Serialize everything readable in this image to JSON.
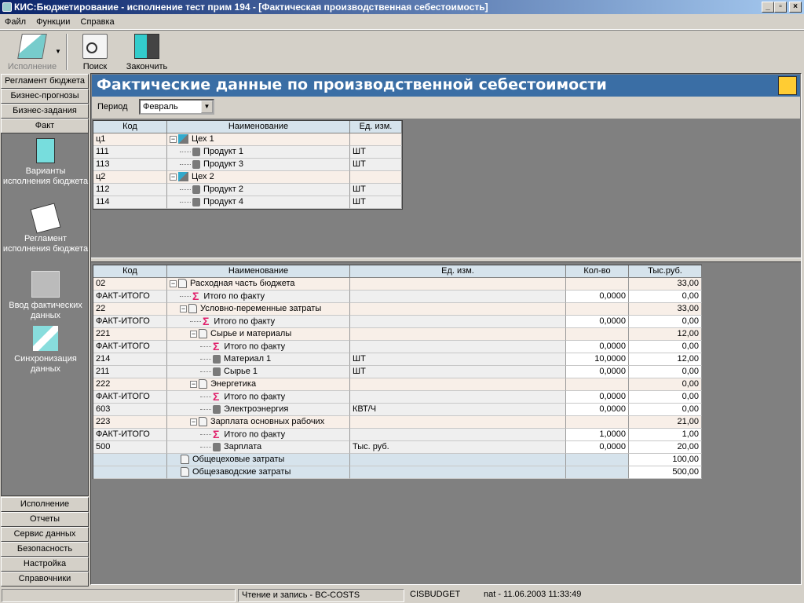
{
  "window": {
    "title": "КИС:Бюджетирование - исполнение тест прим 194 - [Фактическая производственная себестоимость]",
    "min": "_",
    "max": "▫",
    "close": "×"
  },
  "menu": [
    "Файл",
    "Функции",
    "Справка"
  ],
  "toolbar": {
    "execution": "Исполнение",
    "search": "Поиск",
    "finish": "Закончить"
  },
  "sidebar": {
    "top": [
      "Регламент бюджета",
      "Бизнес-прогнозы",
      "Бизнес-задания",
      "Факт"
    ],
    "items": [
      {
        "label": "Варианты исполнения бюджета",
        "icon": "book-icon"
      },
      {
        "label": "Регламент исполнения бюджета",
        "icon": "pinned-note-icon"
      },
      {
        "label": "Ввод фактических данных",
        "icon": "data-entry-icon"
      },
      {
        "label": "Синхронизация данных",
        "icon": "sync-folders-icon"
      }
    ],
    "bottom": [
      "Исполнение",
      "Отчеты",
      "Сервис данных",
      "Безопасность",
      "Настройка",
      "Справочники"
    ]
  },
  "page": {
    "title": "Фактические данные по производственной себестоимости",
    "period_label": "Период",
    "period_value": "Февраль"
  },
  "grid1": {
    "headers": [
      "Код",
      "Наименование",
      "Ед. изм."
    ],
    "rows": [
      {
        "code": "ц1",
        "name": "Цех 1",
        "unit": "",
        "level": 0,
        "type": "shop"
      },
      {
        "code": "111",
        "name": "Продукт 1",
        "unit": "ШТ",
        "level": 1,
        "type": "item"
      },
      {
        "code": "113",
        "name": "Продукт 3",
        "unit": "ШТ",
        "level": 1,
        "type": "item"
      },
      {
        "code": "ц2",
        "name": "Цех 2",
        "unit": "",
        "level": 0,
        "type": "shop"
      },
      {
        "code": "112",
        "name": "Продукт 2",
        "unit": "ШТ",
        "level": 1,
        "type": "item"
      },
      {
        "code": "114",
        "name": "Продукт 4",
        "unit": "ШТ",
        "level": 1,
        "type": "item"
      }
    ]
  },
  "grid2": {
    "headers": [
      "Код",
      "Наименование",
      "Ед. изм.",
      "Кол-во",
      "Тыс.руб."
    ],
    "rows": [
      {
        "code": "02",
        "name": "Расходная часть бюджета",
        "unit": "",
        "qty": "",
        "sum": "33,00",
        "level": 0,
        "type": "group"
      },
      {
        "code": "ФАКТ-ИТОГО",
        "name": "Итого по факту",
        "unit": "",
        "qty": "0,0000",
        "sum": "0,00",
        "level": 1,
        "type": "sum"
      },
      {
        "code": "22",
        "name": "Условно-переменные затраты",
        "unit": "",
        "qty": "",
        "sum": "33,00",
        "level": 1,
        "type": "group"
      },
      {
        "code": "ФАКТ-ИТОГО",
        "name": "Итого по факту",
        "unit": "",
        "qty": "0,0000",
        "sum": "0,00",
        "level": 2,
        "type": "sum"
      },
      {
        "code": "221",
        "name": "Сырье и материалы",
        "unit": "",
        "qty": "",
        "sum": "12,00",
        "level": 2,
        "type": "group"
      },
      {
        "code": "ФАКТ-ИТОГО",
        "name": "Итого по факту",
        "unit": "",
        "qty": "0,0000",
        "sum": "0,00",
        "level": 3,
        "type": "sum"
      },
      {
        "code": "214",
        "name": "Материал 1",
        "unit": "ШТ",
        "qty": "10,0000",
        "sum": "12,00",
        "level": 3,
        "type": "item"
      },
      {
        "code": "211",
        "name": "Сырье 1",
        "unit": "ШТ",
        "qty": "0,0000",
        "sum": "0,00",
        "level": 3,
        "type": "item"
      },
      {
        "code": "222",
        "name": "Энергетика",
        "unit": "",
        "qty": "",
        "sum": "0,00",
        "level": 2,
        "type": "group"
      },
      {
        "code": "ФАКТ-ИТОГО",
        "name": "Итого по факту",
        "unit": "",
        "qty": "0,0000",
        "sum": "0,00",
        "level": 3,
        "type": "sum"
      },
      {
        "code": "603",
        "name": "Электроэнергия",
        "unit": "КВТ/Ч",
        "qty": "0,0000",
        "sum": "0,00",
        "level": 3,
        "type": "item"
      },
      {
        "code": "223",
        "name": "Зарплата основных рабочих",
        "unit": "",
        "qty": "",
        "sum": "21,00",
        "level": 2,
        "type": "group"
      },
      {
        "code": "ФАКТ-ИТОГО",
        "name": "Итого по факту",
        "unit": "",
        "qty": "1,0000",
        "sum": "1,00",
        "level": 3,
        "type": "sum"
      },
      {
        "code": "500",
        "name": "Зарплата",
        "unit": "Тыс. руб.",
        "qty": "0,0000",
        "sum": "20,00",
        "level": 3,
        "type": "item"
      },
      {
        "code": "",
        "name": "Общецеховые затраты",
        "unit": "",
        "qty": "",
        "sum": "100,00",
        "level": 0,
        "type": "total"
      },
      {
        "code": "",
        "name": "Общезаводские затраты",
        "unit": "",
        "qty": "",
        "sum": "500,00",
        "level": 0,
        "type": "total"
      }
    ]
  },
  "status": {
    "mode": "Чтение и запись - BC-COSTS",
    "db": "CISBUDGET",
    "user": "nat - 11.06.2003 11:33:49"
  }
}
